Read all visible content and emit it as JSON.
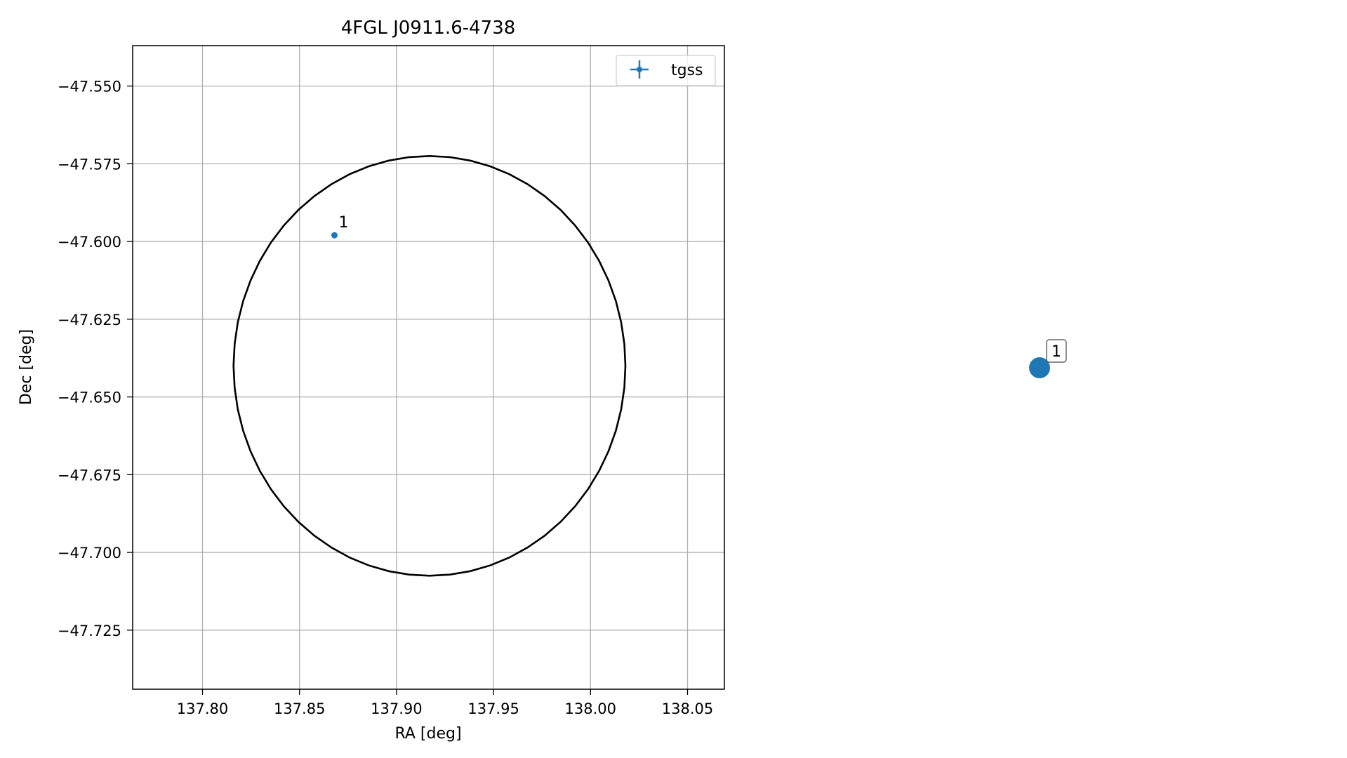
{
  "chart_data": [
    {
      "type": "scatter",
      "title": "4FGL J0911.6-4738",
      "xlabel": "RA [deg]",
      "ylabel": "Dec [deg]",
      "xlim": [
        137.764,
        138.069
      ],
      "ylim": [
        -47.744,
        -47.537
      ],
      "xticks": [
        137.8,
        137.85,
        137.9,
        137.95,
        138.0,
        138.05
      ],
      "xtick_labels": [
        "137.80",
        "137.85",
        "137.90",
        "137.95",
        "138.00",
        "138.05"
      ],
      "yticks": [
        -47.55,
        -47.575,
        -47.6,
        -47.625,
        -47.65,
        -47.675,
        -47.7,
        -47.725
      ],
      "ytick_labels": [
        "−47.550",
        "−47.575",
        "−47.600",
        "−47.625",
        "−47.650",
        "−47.675",
        "−47.700",
        "−47.725"
      ],
      "grid": true,
      "legend": {
        "position": "top-right",
        "entries": [
          {
            "label": "tgss",
            "color": "#1f77b4",
            "marker": "plus-with-point"
          }
        ]
      },
      "series": [
        {
          "name": "tgss",
          "color": "#1f77b4",
          "points": [
            {
              "x": 137.868,
              "y": -47.598,
              "label": "1"
            }
          ]
        }
      ],
      "ellipse": {
        "center": [
          137.917,
          -47.64
        ],
        "ra_half_axis": 0.101,
        "dec_half_axis": 0.0675,
        "color": "#000000"
      }
    },
    {
      "type": "scatter",
      "axes_visible": false,
      "series": [
        {
          "color": "#1f77b4",
          "points": [
            {
              "x": 0,
              "y": 0,
              "label": "1"
            }
          ]
        }
      ]
    }
  ]
}
